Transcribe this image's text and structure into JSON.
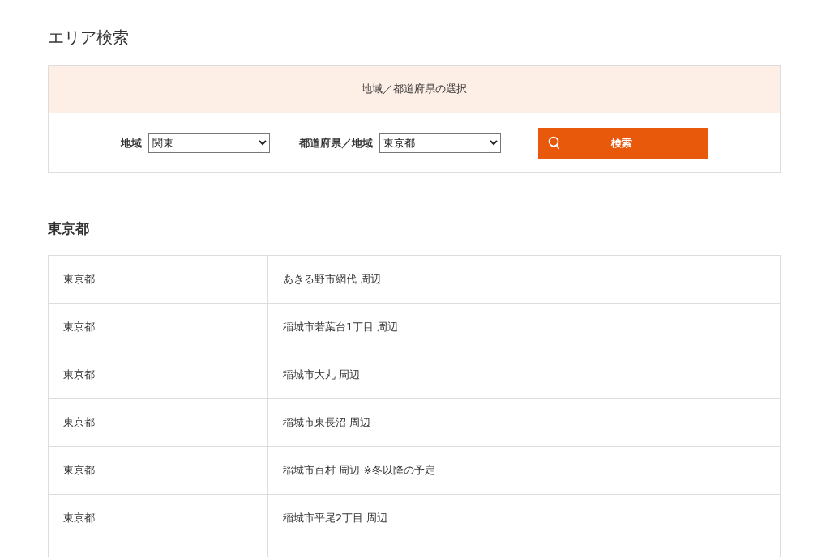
{
  "page_title": "エリア検索",
  "selection_panel": {
    "heading": "地域／都道府県の選択",
    "fields": [
      {
        "label": "地域",
        "value": "関東"
      },
      {
        "label": "都道府県／地域",
        "value": "東京都"
      }
    ],
    "search_button": "検索"
  },
  "section_heading": "東京都",
  "rows": [
    {
      "prefecture": "東京都",
      "area": "あきる野市網代 周辺"
    },
    {
      "prefecture": "東京都",
      "area": "稲城市若葉台1丁目 周辺"
    },
    {
      "prefecture": "東京都",
      "area": "稲城市大丸 周辺"
    },
    {
      "prefecture": "東京都",
      "area": "稲城市東長沼 周辺"
    },
    {
      "prefecture": "東京都",
      "area": "稲城市百村 周辺 ※冬以降の予定"
    },
    {
      "prefecture": "東京都",
      "area": "稲城市平尾2丁目 周辺"
    }
  ]
}
